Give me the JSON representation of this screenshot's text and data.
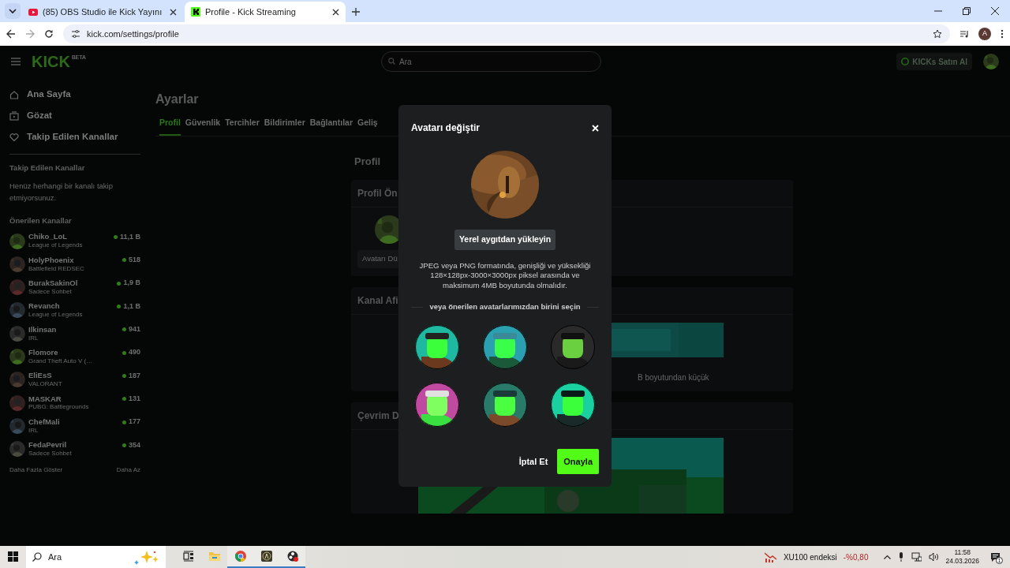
{
  "browser": {
    "tabs": [
      {
        "title": "(85) OBS Studio ile Kick Yayını",
        "kind": "video",
        "selected": false
      },
      {
        "title": "Profile - Kick Streaming",
        "kind": "kick",
        "selected": true
      }
    ],
    "url": "kick.com/settings/profile",
    "profile_initial": "A"
  },
  "header": {
    "logo": "KICK",
    "logo_badge": "BETA",
    "search": {
      "placeholder": "Ara"
    },
    "buy_button": "KICKs Satın Al"
  },
  "sidebar": {
    "nav": [
      {
        "label": "Ana Sayfa",
        "kind": "home"
      },
      {
        "label": "Gözat",
        "kind": "browse"
      },
      {
        "label": "Takip Edilen Kanallar",
        "kind": "heart"
      }
    ],
    "followed_title": "Takip Edilen Kanallar",
    "followed_empty": "Henüz herhangi bir kanalı takip etmiyorsunuz.",
    "recommended_title": "Önerilen Kanallar",
    "channels": [
      {
        "name": "Chiko_LoL",
        "category": "League of Legends",
        "viewers": "11,1 B"
      },
      {
        "name": "HolyPhoenix",
        "category": "Battlefield REDSEC",
        "viewers": "518"
      },
      {
        "name": "BurakSakinOl",
        "category": "Sadece Sohbet",
        "viewers": "1,9 B"
      },
      {
        "name": "Revanch",
        "category": "League of Legends",
        "viewers": "1,1 B"
      },
      {
        "name": "Ilkinsan",
        "category": "IRL",
        "viewers": "941"
      },
      {
        "name": "Flomore",
        "category": "Grand Theft Auto V (…",
        "viewers": "490"
      },
      {
        "name": "EliEsS",
        "category": "VALORANT",
        "viewers": "187"
      },
      {
        "name": "MASKAR",
        "category": "PUBG: Battlegrounds",
        "viewers": "131"
      },
      {
        "name": "ChefMali",
        "category": "IRL",
        "viewers": "177"
      },
      {
        "name": "FedaPevril",
        "category": "Sadece Sohbet",
        "viewers": "354"
      }
    ],
    "show_more": "Daha Fazla Göster",
    "show_less": "Daha Az"
  },
  "settings": {
    "title": "Ayarlar",
    "tabs": [
      {
        "label": "Profil",
        "selected": true
      },
      {
        "label": "Güvenlik",
        "selected": false
      },
      {
        "label": "Tercihler",
        "selected": false
      },
      {
        "label": "Bildirimler",
        "selected": false
      },
      {
        "label": "Bağlantılar",
        "selected": false
      },
      {
        "label": "Geliş",
        "selected": false
      }
    ],
    "section_title": "Profil",
    "cards": [
      {
        "kind": "avatar",
        "title": "Profil Ön",
        "button": "Avatarı Dü"
      },
      {
        "kind": "banner",
        "title": "Kanal Afi",
        "note": "B boyutundan küçük"
      },
      {
        "kind": "offline",
        "title": "Çevrim D"
      }
    ]
  },
  "modal": {
    "title": "Avatarı değiştir",
    "upload_button": "Yerel aygıtdan yükleyin",
    "hint": "JPEG veya PNG formatında, genişliği ve yüksekliği 128×128px-3000×3000px piksel arasında ve maksimum 4MB boyutunda olmalıdır.",
    "divider_text": "veya önerilen avatarlarımızdan birini seçin",
    "cancel_button": "İptal Et",
    "confirm_button": "Onayla"
  },
  "taskbar": {
    "search": {
      "placeholder": "Ara"
    },
    "apps": [
      {
        "kind": "taskview",
        "running": false
      },
      {
        "kind": "explorer",
        "running": false
      },
      {
        "kind": "chrome",
        "running": true
      },
      {
        "kind": "game",
        "running": true
      },
      {
        "kind": "obs",
        "running": true
      }
    ],
    "stock": {
      "label": "XU100 endeksi",
      "change": "-%0,80"
    },
    "time": "11:58",
    "date": "24.03.2026",
    "notifications": "1"
  }
}
